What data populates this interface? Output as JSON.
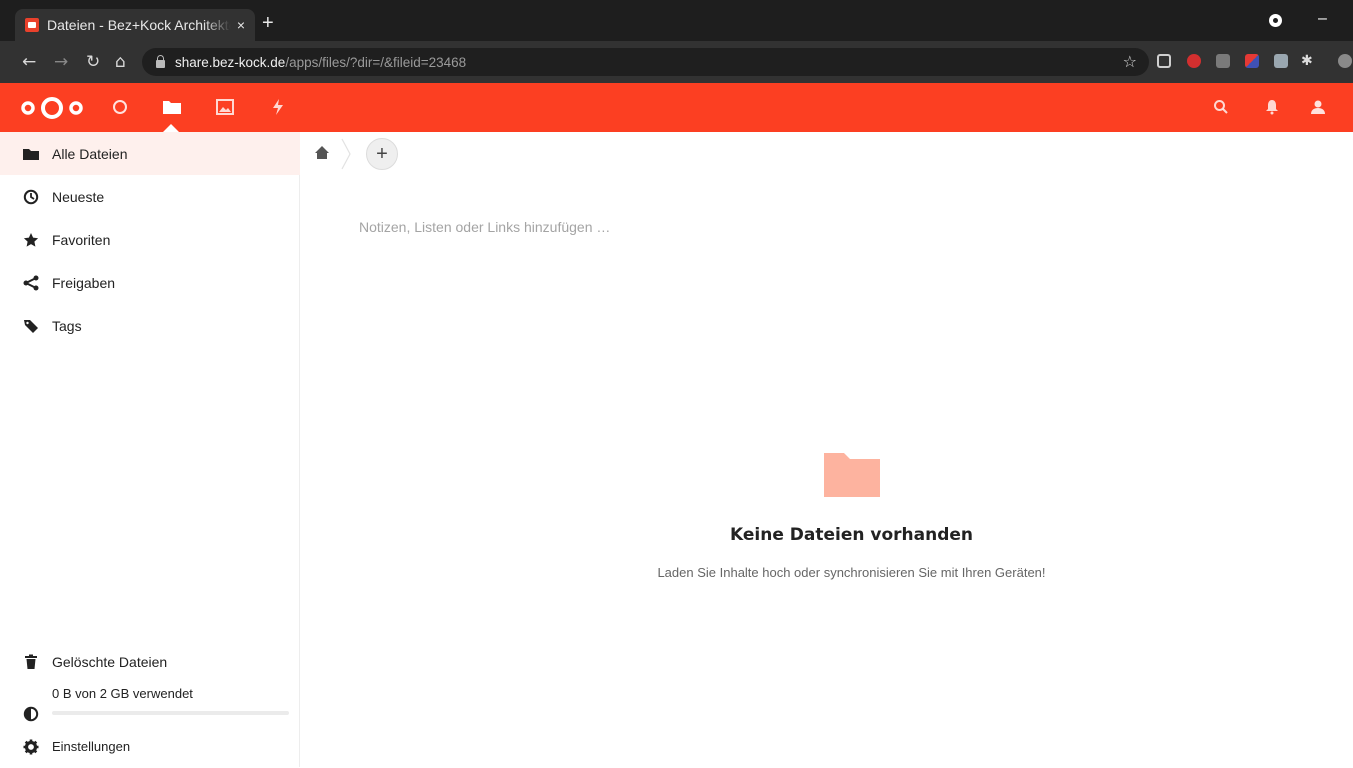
{
  "browser": {
    "tab_title": "Dateien - Bez+Kock Architekten",
    "tab_close": "×",
    "new_tab": "+",
    "url_host": "share.bez-kock.de",
    "url_path": "/apps/files/?dir=/&fileid=23468",
    "minimize": "–"
  },
  "header": {
    "apps": [
      {
        "name": "dashboard-icon"
      },
      {
        "name": "files-icon"
      },
      {
        "name": "photos-icon"
      },
      {
        "name": "activity-icon"
      }
    ],
    "right": [
      "search-icon",
      "notifications-icon",
      "contacts-icon"
    ]
  },
  "sidebar": {
    "items": [
      {
        "label": "Alle Dateien",
        "icon": "folder-icon",
        "active": true
      },
      {
        "label": "Neueste",
        "icon": "clock-icon"
      },
      {
        "label": "Favoriten",
        "icon": "star-icon"
      },
      {
        "label": "Freigaben",
        "icon": "share-icon"
      },
      {
        "label": "Tags",
        "icon": "tag-icon"
      }
    ],
    "bottom": {
      "trash": "Gelöschte Dateien",
      "quota": "0 B von 2 GB verwendet",
      "quota_used_fraction": 0,
      "settings": "Einstellungen"
    }
  },
  "main": {
    "add_button": "+",
    "rich_workspace_placeholder": "Notizen, Listen oder Links hinzufügen …",
    "empty_title": "Keine Dateien vorhanden",
    "empty_subtitle": "Laden Sie Inhalte hoch oder synchronisieren Sie mit Ihren Geräten!"
  },
  "colors": {
    "brand": "#fc3f22",
    "empty_folder": "#fdb39f",
    "active_bg": "#fef0ed"
  }
}
